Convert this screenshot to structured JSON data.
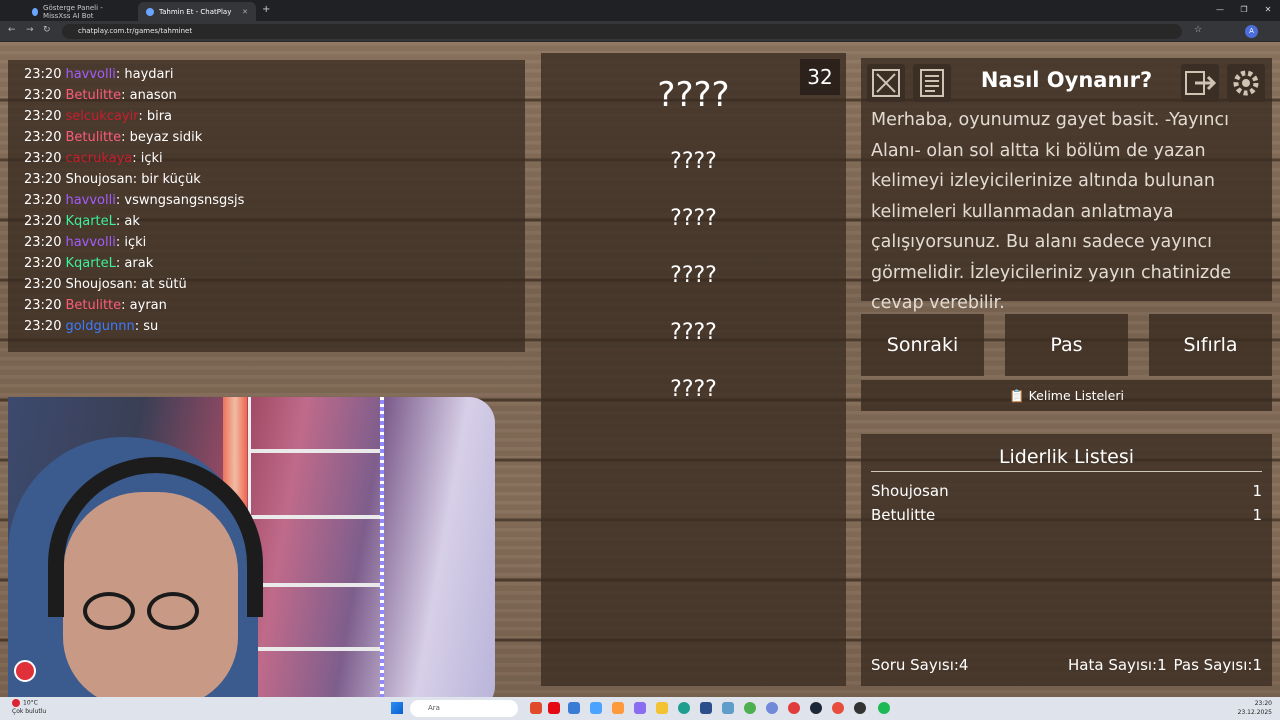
{
  "browser": {
    "tabs": [
      {
        "title": "Gösterge Paneli - MissXss AI Bot"
      },
      {
        "title": "Tahmin Et - ChatPlay"
      }
    ],
    "url": "chatplay.com.tr/games/tahminet",
    "profile_initial": "A"
  },
  "chat": {
    "messages": [
      {
        "time": "23:20",
        "user": "havvolli",
        "color": "#a35cff",
        "text": ": haydari"
      },
      {
        "time": "23:20",
        "user": "Betulitte",
        "color": "#ff5a7d",
        "text": ": anason"
      },
      {
        "time": "23:20",
        "user": "selcukcayir",
        "color": "#c81e2e",
        "text": ": bira"
      },
      {
        "time": "23:20",
        "user": "Betulitte",
        "color": "#ff5a7d",
        "text": ": beyaz sidik"
      },
      {
        "time": "23:20",
        "user": "cacrukaya",
        "color": "#c81e2e",
        "text": ": içki"
      },
      {
        "time": "23:20",
        "user": "Shoujosan",
        "color": "#ffffff",
        "text": ": bir küçük"
      },
      {
        "time": "23:20",
        "user": "havvolli",
        "color": "#a35cff",
        "text": ": vswngsangsnsgsjs"
      },
      {
        "time": "23:20",
        "user": "KqarteL",
        "color": "#3ef09a",
        "text": ": ak"
      },
      {
        "time": "23:20",
        "user": "havvolli",
        "color": "#a35cff",
        "text": ": içki"
      },
      {
        "time": "23:20",
        "user": "KqarteL",
        "color": "#3ef09a",
        "text": ": arak"
      },
      {
        "time": "23:20",
        "user": "Shoujosan",
        "color": "#ffffff",
        "text": ": at sütü"
      },
      {
        "time": "23:20",
        "user": "Betulitte",
        "color": "#ff5a7d",
        "text": ": ayran"
      },
      {
        "time": "23:20",
        "user": "goldgunnn",
        "color": "#3c7cff",
        "text": ": su"
      }
    ]
  },
  "game": {
    "timer": "32",
    "main_word": "????",
    "hidden_words": [
      "????",
      "????",
      "????",
      "????",
      "????"
    ]
  },
  "info": {
    "title": "Nasıl Oynanır?",
    "text": "Merhaba, oyunumuz gayet basit. -Yayıncı Alanı- olan sol altta ki bölüm de yazan kelimeyi izleyicilerinize altında bulunan kelimeleri kullanmadan anlatmaya çalışıyorsunuz. Bu alanı sadece yayıncı görmelidir. İzleyicileriniz yayın chatinizde cevap verebilir."
  },
  "buttons": {
    "next": "Sonraki",
    "pass": "Pas",
    "reset": "Sıfırla",
    "word_lists": "📋 Kelime Listeleri"
  },
  "leaderboard": {
    "title": "Liderlik Listesi",
    "rows": [
      {
        "name": "Shoujosan",
        "score": "1"
      },
      {
        "name": "Betulitte",
        "score": "1"
      }
    ]
  },
  "stats": {
    "questions": "Soru Sayısı:4",
    "errors": "Hata Sayısı:1",
    "passes": "Pas Sayısı:1"
  },
  "taskbar": {
    "weather_temp": "10°C",
    "weather_desc": "Çok bulutlu",
    "search_placeholder": "Ara",
    "time": "23:20",
    "date": "23.12.2025"
  }
}
